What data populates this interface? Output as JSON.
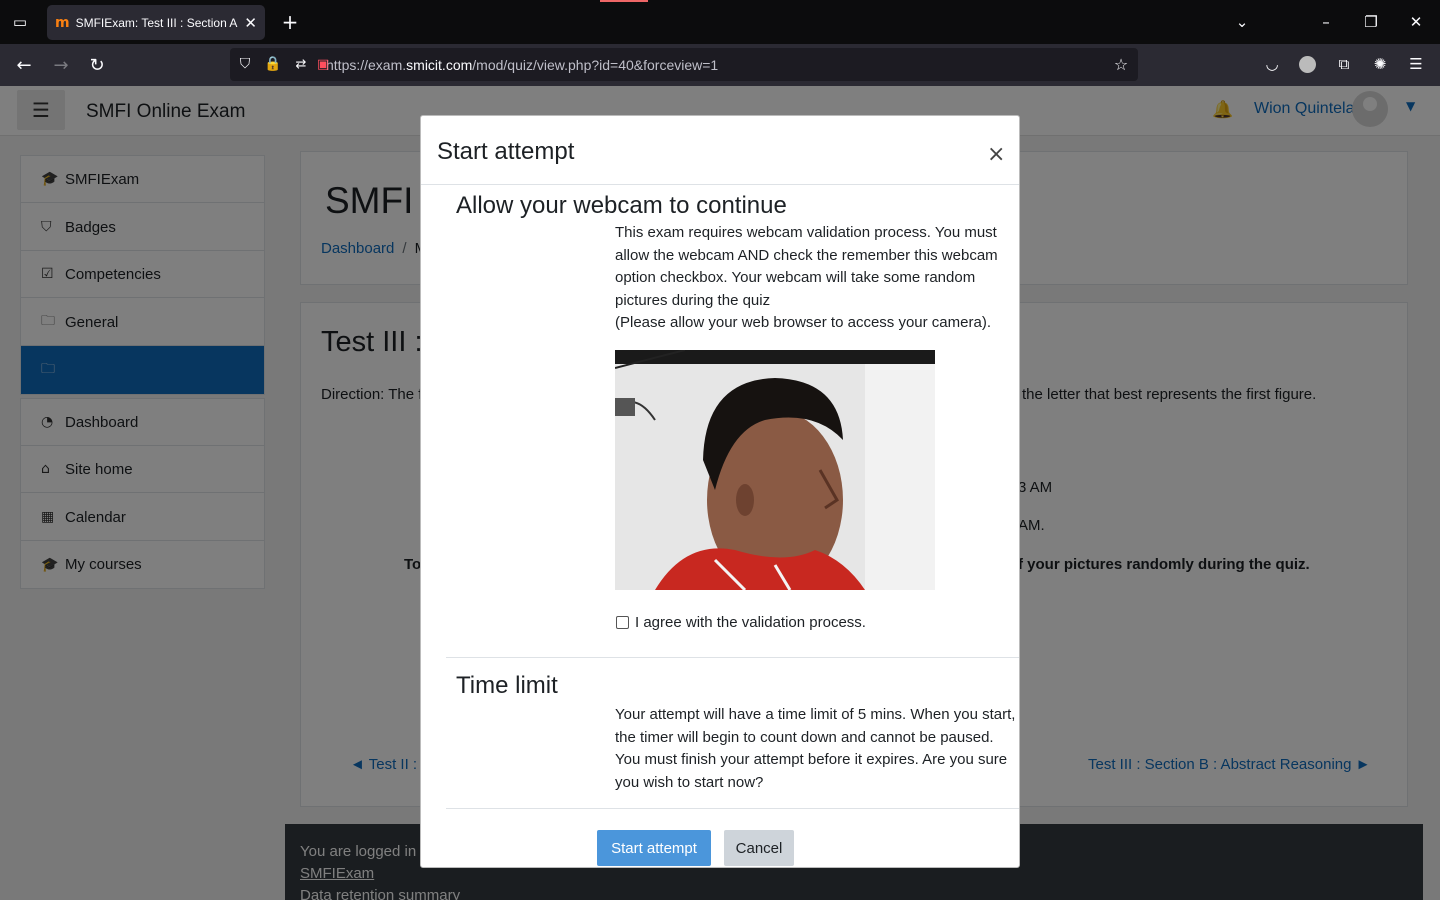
{
  "browser": {
    "tab_title": "SMFIExam: Test III : Section A : S",
    "tab_favicon": "m",
    "url_prefix": "https://exam.",
    "url_domain": "smicit.com",
    "url_path": "/mod/quiz/view.php?id=40&forceview=1"
  },
  "header": {
    "site_title": "SMFI Online Exam",
    "user_name": "Wion Quintela"
  },
  "sidebar": {
    "block1": [
      {
        "label": "SMFIExam",
        "icon": "graduation-cap-icon",
        "glyph": "🎓"
      },
      {
        "label": "Badges",
        "icon": "shield-icon",
        "glyph": "⛉"
      },
      {
        "label": "Competencies",
        "icon": "check-square-icon",
        "glyph": "☑"
      },
      {
        "label": "General",
        "icon": "folder-icon",
        "glyph": "🗀"
      },
      {
        "label": "",
        "icon": "folder-icon",
        "glyph": "🗀",
        "active": true
      }
    ],
    "block2": [
      {
        "label": "Dashboard",
        "icon": "dashboard-icon",
        "glyph": "◔"
      },
      {
        "label": "Site home",
        "icon": "home-icon",
        "glyph": "⌂"
      },
      {
        "label": "Calendar",
        "icon": "calendar-icon",
        "glyph": "▦"
      },
      {
        "label": "My courses",
        "icon": "graduation-cap-icon",
        "glyph": "🎓"
      }
    ]
  },
  "main": {
    "course_title": "SMFI S",
    "breadcrumb": [
      "Dashboard",
      "/",
      "M"
    ],
    "quiz_title": "Test III :",
    "direction_left": "Direction: The f",
    "direction_right": "the letter that best represents the first figure.",
    "opened_fragment": "3 AM",
    "closed_fragment": "AM.",
    "notice_left": "To",
    "notice_right": "f your pictures randomly during the quiz.",
    "prev_link": "◄ Test II : N",
    "next_link": "Test III : Section B : Abstract Reasoning ►"
  },
  "footer": {
    "logged_in": "You are logged in",
    "course_link": "SMFIExam",
    "data_retention": "Data retention summary"
  },
  "modal": {
    "title": "Start attempt",
    "close": "×",
    "webcam_heading": "Allow your webcam to continue",
    "webcam_text": "This exam requires webcam validation process. You must allow the webcam AND check the remember this webcam option checkbox. Your webcam will take some random pictures during the quiz",
    "webcam_note": "(Please allow your web browser to access your camera).",
    "agree_label": "I agree with the validation process.",
    "agree_checked": false,
    "time_heading": "Time limit",
    "time_text": "Your attempt will have a time limit of 5 mins. When you start, the timer will begin to count down and cannot be paused. You must finish your attempt before it expires. Are you sure you wish to start now?",
    "start_button": "Start attempt",
    "cancel_button": "Cancel"
  },
  "colors": {
    "accent": "#0f6cbf",
    "start_button": "#4b96db",
    "footer": "#343a40"
  }
}
